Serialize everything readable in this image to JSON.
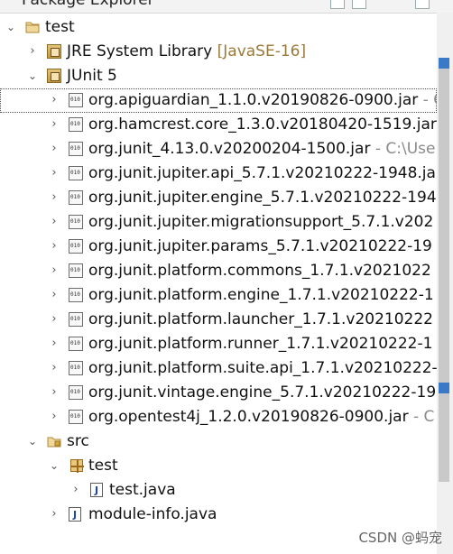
{
  "view": {
    "title": "Package Explorer"
  },
  "tree": {
    "project": "test",
    "jre": {
      "label": "JRE System Library",
      "decoration": "[JavaSE-16]"
    },
    "junit": {
      "label": "JUnit 5"
    },
    "jars": [
      {
        "name": "org.apiguardian_1.1.0.v20190826-0900.jar",
        "path": " - C:\\"
      },
      {
        "name": "org.hamcrest.core_1.3.0.v20180420-1519.jar",
        "path": ""
      },
      {
        "name": "org.junit_4.13.0.v20200204-1500.jar",
        "path": " - C:\\Use"
      },
      {
        "name": "org.junit.jupiter.api_5.7.1.v20210222-1948.ja",
        "path": ""
      },
      {
        "name": "org.junit.jupiter.engine_5.7.1.v20210222-194",
        "path": ""
      },
      {
        "name": "org.junit.jupiter.migrationsupport_5.7.1.v202",
        "path": ""
      },
      {
        "name": "org.junit.jupiter.params_5.7.1.v20210222-19",
        "path": ""
      },
      {
        "name": "org.junit.platform.commons_1.7.1.v2021022",
        "path": ""
      },
      {
        "name": "org.junit.platform.engine_1.7.1.v20210222-1",
        "path": ""
      },
      {
        "name": "org.junit.platform.launcher_1.7.1.v20210222",
        "path": ""
      },
      {
        "name": "org.junit.platform.runner_1.7.1.v20210222-1",
        "path": ""
      },
      {
        "name": "org.junit.platform.suite.api_1.7.1.v20210222-",
        "path": ""
      },
      {
        "name": "org.junit.vintage.engine_5.7.1.v20210222-19",
        "path": ""
      },
      {
        "name": "org.opentest4j_1.2.0.v20190826-0900.jar",
        "path": " - C"
      }
    ],
    "src": {
      "label": "src"
    },
    "package": {
      "label": "test"
    },
    "test_java": {
      "label": "test.java"
    },
    "module_info": {
      "label": "module-info.java"
    }
  },
  "watermark": "CSDN @蚂宠"
}
